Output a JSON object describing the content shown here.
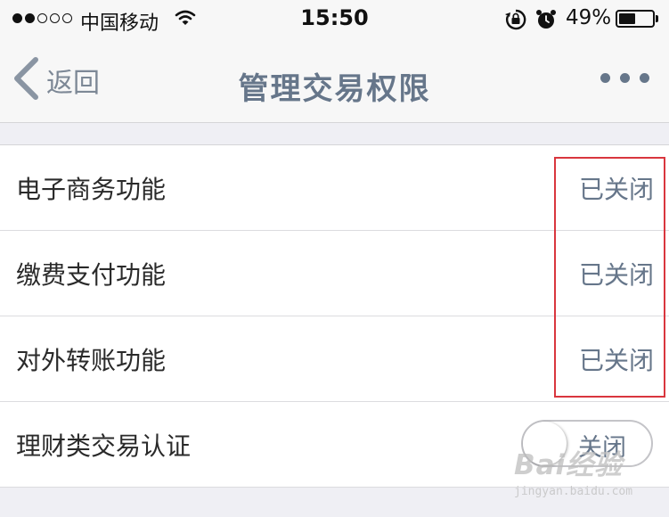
{
  "status_bar": {
    "carrier": "中国移动",
    "time": "15:50",
    "battery_percent": "49%",
    "battery_level": 0.49,
    "signal_bars_filled": 2,
    "signal_bars_total": 5
  },
  "nav": {
    "back_label": "返回",
    "title": "管理交易权限",
    "more_icon": "more-dots-icon"
  },
  "rows": [
    {
      "label": "电子商务功能",
      "status": "已关闭"
    },
    {
      "label": "缴费支付功能",
      "status": "已关闭"
    },
    {
      "label": "对外转账功能",
      "status": "已关闭"
    },
    {
      "label": "理财类交易认证",
      "toggle_label": "关闭",
      "toggle_on": false
    }
  ],
  "watermark": {
    "brand": "Bai经验",
    "url": "jingyan.baidu.com"
  },
  "colors": {
    "accent": "#66768a",
    "highlight": "#d9363e",
    "background": "#efeff4"
  }
}
